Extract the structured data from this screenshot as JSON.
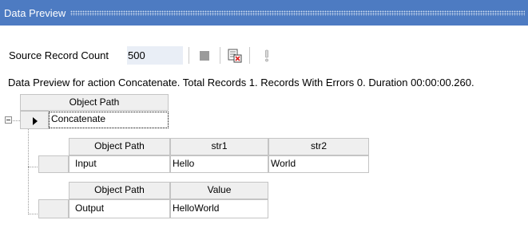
{
  "window": {
    "title": "Data Preview"
  },
  "toolbar": {
    "source_record_count_label": "Source Record Count",
    "source_record_count_value": "500",
    "buttons": [
      {
        "name": "stop-icon"
      },
      {
        "name": "preview-errors-icon"
      },
      {
        "name": "exclamation-icon"
      }
    ]
  },
  "status": {
    "text": "Data Preview for action Concatenate. Total Records 1. Records With Errors 0. Duration 00:00:00.260."
  },
  "root_grid": {
    "header": "Object Path",
    "row": "Concatenate"
  },
  "input_grid": {
    "headers": [
      "Object Path",
      "str1",
      "str2"
    ],
    "rows": [
      [
        "Input",
        "Hello",
        "World"
      ]
    ]
  },
  "output_grid": {
    "headers": [
      "Object Path",
      "Value"
    ],
    "rows": [
      [
        "Output",
        "HelloWorld"
      ]
    ]
  }
}
